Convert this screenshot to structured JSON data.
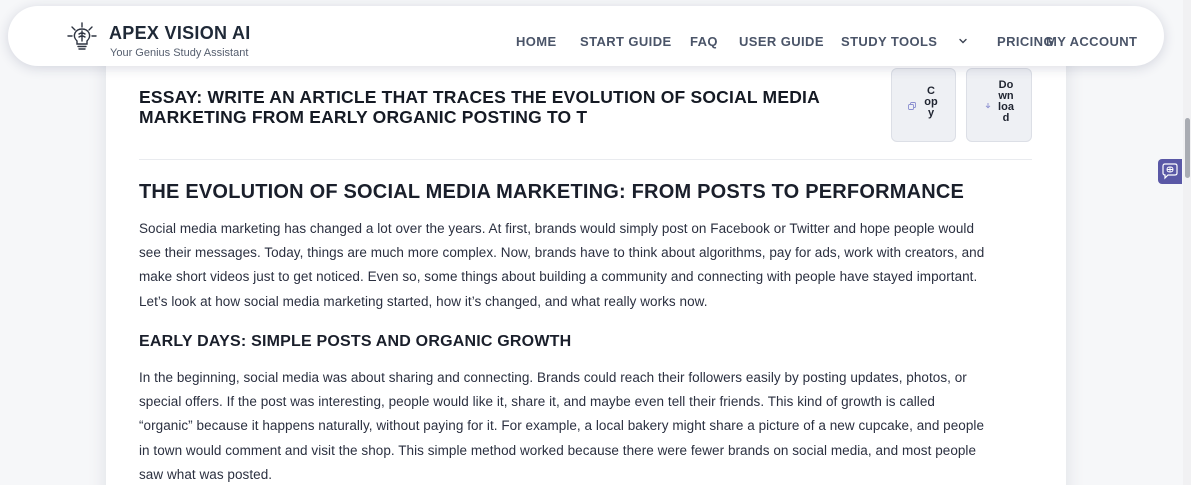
{
  "header": {
    "brand_title": "APEX VISION AI",
    "brand_subtitle": "Your Genius Study Assistant",
    "logo_icon": "lightbulb-brain-icon",
    "nav": [
      {
        "label": "HOME"
      },
      {
        "label": "START GUIDE"
      },
      {
        "label": "FAQ"
      },
      {
        "label": "USER GUIDE"
      },
      {
        "label": "STUDY TOOLS"
      },
      {
        "label": "PRICING"
      },
      {
        "label": "MY ACCOUNT"
      }
    ],
    "dropdown_icon": "chevron-down-icon"
  },
  "essay": {
    "title_lines": [
      "ESSAY: WRITE AN ARTICLE THAT TRACES THE EVOLUTION OF SOCIAL MEDIA",
      "MARKETING FROM EARLY ORGANIC POSTING TO T"
    ],
    "copy_button": {
      "label_lines": [
        "C",
        "op",
        "y"
      ],
      "icon": "copy-icon"
    },
    "download_button": {
      "label_lines": [
        "Do",
        "wn",
        "loa",
        "d"
      ],
      "icon": "download-icon"
    }
  },
  "article": {
    "heading": "THE EVOLUTION OF SOCIAL MEDIA MARKETING: FROM POSTS TO PERFORMANCE",
    "intro_lines": [
      "Social media marketing has changed a lot over the years. At first, brands would simply post on Facebook or Twitter and hope people would",
      "see their messages. Today, things are much more complex. Now, brands have to think about algorithms, pay for ads, work with creators, and",
      "make short videos just to get noticed. Even so, some things about building a community and connecting with people have stayed important.",
      "Let’s look at how social media marketing started, how it’s changed, and what really works now."
    ],
    "section1_heading": "EARLY DAYS: SIMPLE POSTS AND ORGANIC GROWTH",
    "section1_lines": [
      "In the beginning, social media was about sharing and connecting. Brands could reach their followers easily by posting updates, photos, or",
      "special offers. If the post was interesting, people would like it, share it, and maybe even tell their friends. This kind of growth is called",
      "“organic” because it happens naturally, without paying for it. For example, a local bakery might share a picture of a new cupcake, and people",
      "in town would comment and visit the shop. This simple method worked because there were fewer brands on social media, and most people",
      "saw what was posted."
    ]
  },
  "side_widget": {
    "icon": "brain-chat-icon"
  },
  "colors": {
    "accent": "#5a58a6",
    "nav_text": "#4a5468",
    "heading_text": "#1a1f2b",
    "body_text": "#2b3040",
    "button_bg": "#eef0f4"
  }
}
